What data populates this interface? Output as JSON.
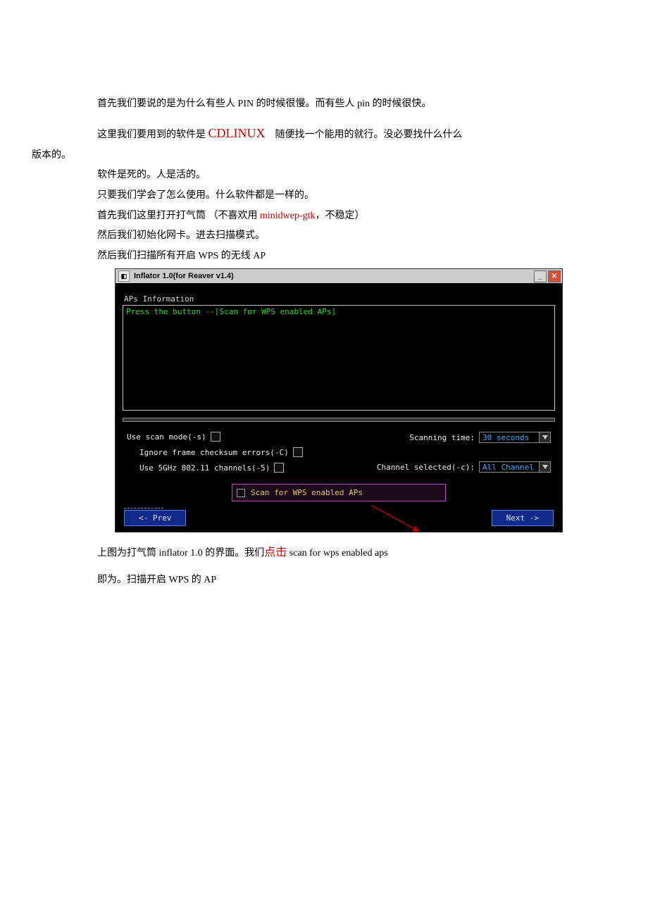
{
  "doc": {
    "p1_prefix": "首先我们要说的是为什么有些人 ",
    "p1_pin1": "PIN",
    "p1_mid": " 的时候很慢。而有些人 ",
    "p1_pin2": "pin",
    "p1_suffix": "  的时候很快。",
    "p2_prefix": "这里我们要用到的软件是 ",
    "p2_cdlinux": "CDLINUX",
    "p2_suffix": "　随便找一个能用的就行。没必要找什么什么",
    "p2b": "版本的。",
    "p3": "软件是死的。人是活的。",
    "p4": "只要我们学会了怎么使用。什么软件都是一样的。",
    "p5_prefix": "首先我们这里打开打气筒 （不喜欢用 ",
    "p5_minidwep": "minidwep-gtk",
    "p5_suffix": "，不稳定）",
    "p6": "然后我们初始化网卡。进去扫描模式。",
    "p7_prefix": "然后我们扫描所有开启 ",
    "p7_wps": "WPS",
    "p7_mid": " 的无线 ",
    "p7_ap": "AP",
    "after1_prefix": "上图为打气筒 ",
    "after1_inflator": "inflator 1.0",
    "after1_mid": " 的界面。我们",
    "after1_click": "点击",
    "after1_scan": " scan for wps enabled aps",
    "after2_prefix": "即为。扫描开启 ",
    "after2_wps": "WPS",
    "after2_mid": " 的 ",
    "after2_ap": "AP"
  },
  "app": {
    "window_title": "Inflator 1.0(for Reaver v1.4)",
    "section_aps": "APs Information",
    "hint": "Press the button --[Scan for WPS enabled APs]",
    "opt_scan_mode": "Use scan mode(-s)",
    "opt_ignore": "Ignore frame checksum errors(-C)",
    "opt_5ghz": "Use 5GHz 802.11 channels(-5)",
    "label_scanning_time": "Scanning time:",
    "val_scanning_time": "30 seconds",
    "label_channel": "Channel selected(-c):",
    "val_channel": "All Channel",
    "scan_button": "Scan for WPS enabled APs",
    "prev": "<- Prev",
    "next": "Next ->"
  }
}
